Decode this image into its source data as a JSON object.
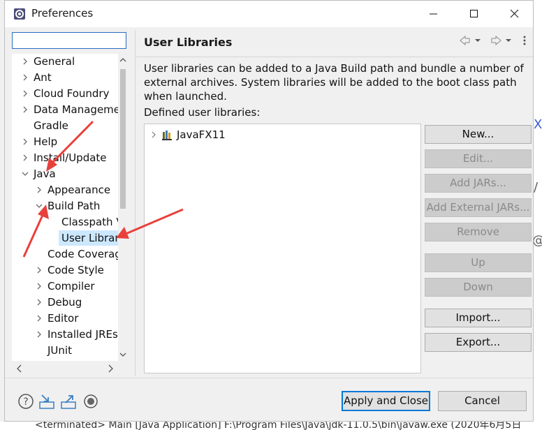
{
  "window": {
    "title": "Preferences",
    "controls": [
      "minimize",
      "maximize",
      "close"
    ]
  },
  "filter": {
    "value": "",
    "placeholder": ""
  },
  "tree": {
    "items": [
      {
        "label": "General",
        "arrow": "right"
      },
      {
        "label": "Ant",
        "arrow": "right"
      },
      {
        "label": "Cloud Foundry",
        "arrow": "right"
      },
      {
        "label": "Data Manageme",
        "arrow": "right"
      },
      {
        "label": "Gradle",
        "arrow": ""
      },
      {
        "label": "Help",
        "arrow": "right"
      },
      {
        "label": "Install/Update",
        "arrow": "right"
      },
      {
        "label": "Java",
        "arrow": "down"
      },
      {
        "label": "Appearance",
        "arrow": "right"
      },
      {
        "label": "Build Path",
        "arrow": "down"
      },
      {
        "label": "Classpath V",
        "arrow": ""
      },
      {
        "label": "User Librar",
        "arrow": "",
        "selected": true
      },
      {
        "label": "Code Coverag",
        "arrow": ""
      },
      {
        "label": "Code Style",
        "arrow": "right"
      },
      {
        "label": "Compiler",
        "arrow": "right"
      },
      {
        "label": "Debug",
        "arrow": "right"
      },
      {
        "label": "Editor",
        "arrow": "right"
      },
      {
        "label": "Installed JREs",
        "arrow": "right"
      },
      {
        "label": "JUnit",
        "arrow": ""
      }
    ]
  },
  "page": {
    "title": "User Libraries",
    "description": "User libraries can be added to a Java Build path and bundle a number of external archives. System libraries will be added to the boot class path when launched.",
    "defined_label": "Defined user libraries:",
    "libraries": [
      {
        "name": "JavaFX11",
        "icon": "library-icon"
      }
    ],
    "buttons": {
      "new": "New...",
      "edit": "Edit...",
      "add_jars": "Add JARs...",
      "add_external_jars": "Add External JARs...",
      "remove": "Remove",
      "up": "Up",
      "down": "Down",
      "import": "Import...",
      "export": "Export..."
    }
  },
  "dialog": {
    "apply_close": "Apply and Close",
    "cancel": "Cancel"
  },
  "background": {
    "status_text": "<terminated> Main [Java Application] F:\\Program Files\\Java\\jdk-11.0.5\\bin\\javaw.exe (2020年6月5日"
  },
  "annotation_color": "#e8413c"
}
